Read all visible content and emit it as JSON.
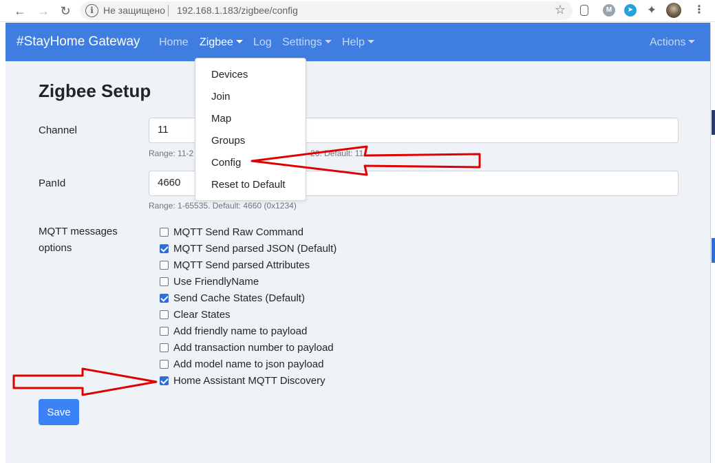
{
  "browser": {
    "security_label": "Не защищено",
    "url": "192.168.1.183/zigbee/config",
    "info_icon": "i",
    "ext_m_label": "M"
  },
  "navbar": {
    "brand": "#StayHome Gateway",
    "links": [
      "Home",
      "Zigbee",
      "Log",
      "Settings",
      "Help"
    ],
    "actions": "Actions"
  },
  "dropdown": {
    "items": [
      "Devices",
      "Join",
      "Map",
      "Groups",
      "Config",
      "Reset to Default"
    ]
  },
  "page": {
    "title": "Zigbee Setup",
    "channel": {
      "label": "Channel",
      "value": "11",
      "help_visible": "Range: 11-2",
      "help_visible_right": "26. Default: 11"
    },
    "panid": {
      "label": "PanId",
      "value": "4660",
      "help": "Range: 1-65535. Default: 4660 (0x1234)"
    },
    "mqtt": {
      "label_line1": "MQTT messages",
      "label_line2": "options",
      "options": [
        {
          "label": "MQTT Send Raw Command",
          "checked": false
        },
        {
          "label": "MQTT Send parsed JSON (Default)",
          "checked": true
        },
        {
          "label": "MQTT Send parsed Attributes",
          "checked": false
        },
        {
          "label": "Use FriendlyName",
          "checked": false
        },
        {
          "label": "Send Cache States (Default)",
          "checked": true
        },
        {
          "label": "Clear States",
          "checked": false
        },
        {
          "label": "Add friendly name to payload",
          "checked": false
        },
        {
          "label": "Add transaction number to payload",
          "checked": false
        },
        {
          "label": "Add model name to json payload",
          "checked": false
        },
        {
          "label": "Home Assistant MQTT Discovery",
          "checked": true
        }
      ]
    },
    "save_label": "Save"
  },
  "colors": {
    "navbar": "#3f7de0",
    "button": "#3b82f6",
    "checkbox": "#2f6fd6",
    "annotation_arrow": "#e00000"
  }
}
